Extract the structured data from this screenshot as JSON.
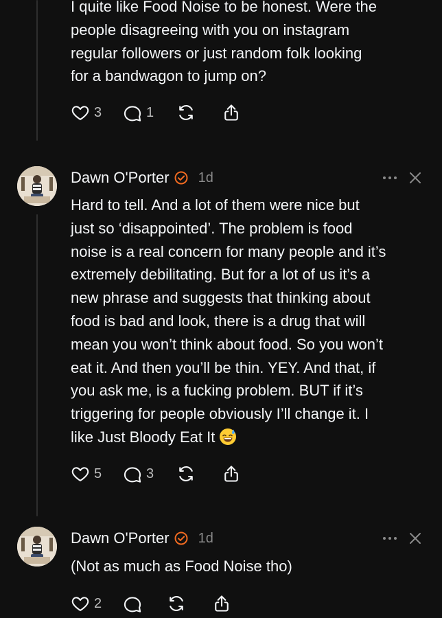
{
  "post_top": {
    "text": "I quite like Food Noise to be honest. Were the\npeople disagreeing with you on instagram\nregular followers or just random folk looking\nfor a bandwagon to jump on?",
    "likes": "3",
    "replies": "1"
  },
  "post_main": {
    "username": "Dawn O'Porter",
    "time": "1d",
    "text": "Hard to tell. And a lot of them were nice but\njust so ‘disappointed’. The problem is food\nnoise is a real concern for many people and it’s\nextremely debilitating. But for a lot of us it’s a\nnew phrase and suggests that thinking about\nfood is bad and look, there is a drug that will\nmean you won’t think about food. So you won’t\neat it. And then you’ll be thin. YEY. And that, if\nyou ask me, is a fucking problem. BUT if it’s\ntriggering for people obviously I’ll change it. I\nlike Just Bloody Eat It",
    "emoji": "sweat-smile",
    "likes": "5",
    "replies": "3"
  },
  "post_bottom": {
    "username": "Dawn O'Porter",
    "time": "1d",
    "text": "(Not as much as Food Noise tho)",
    "likes": "2"
  },
  "colors": {
    "background": "#101010",
    "text": "#f3f5f7",
    "muted": "#8a8a8a",
    "verified_badge": "#f26b21"
  },
  "icons": [
    "heart-icon",
    "comment-icon",
    "repost-icon",
    "share-icon",
    "verified-badge-icon",
    "more-icon",
    "close-icon"
  ]
}
